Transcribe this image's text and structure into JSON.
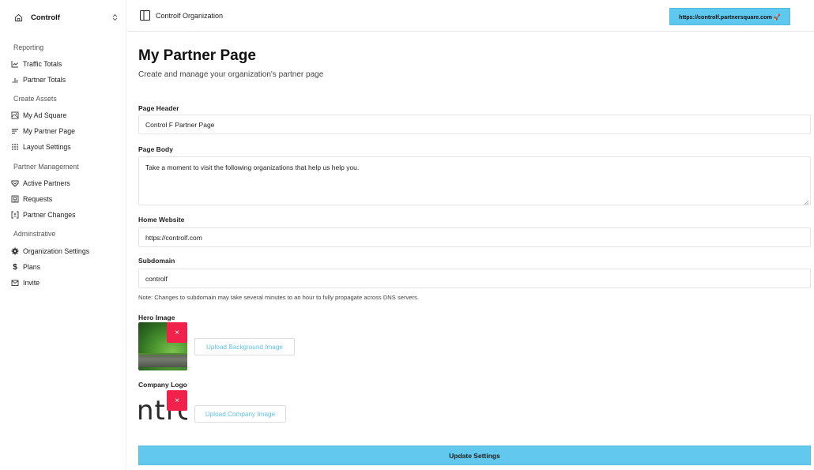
{
  "sidebar": {
    "org_name": "Controlf",
    "sections": [
      {
        "title": "Reporting",
        "items": [
          {
            "label": "Traffic Totals",
            "icon": "line-chart-icon"
          },
          {
            "label": "Partner Totals",
            "icon": "bar-chart-icon"
          }
        ]
      },
      {
        "title": "Create Assets",
        "items": [
          {
            "label": "My Ad Square",
            "icon": "image-square-icon"
          },
          {
            "label": "My Partner Page",
            "icon": "text-align-icon"
          },
          {
            "label": "Layout Settings",
            "icon": "grid-dots-icon"
          }
        ]
      },
      {
        "title": "Partner Management",
        "items": [
          {
            "label": "Active Partners",
            "icon": "handshake-icon"
          },
          {
            "label": "Requests",
            "icon": "inbox-icon"
          },
          {
            "label": "Partner Changes",
            "icon": "diff-icon"
          }
        ]
      },
      {
        "title": "Adminstrative",
        "items": [
          {
            "label": "Organization Settings",
            "icon": "gear-icon"
          },
          {
            "label": "Plans",
            "icon": "dollar-icon"
          },
          {
            "label": "Invite",
            "icon": "mail-icon"
          }
        ]
      }
    ]
  },
  "topbar": {
    "title": "Controlf Organization",
    "url_badge": "https://controlf.partnersquare.com 🚀"
  },
  "page": {
    "title": "My Partner Page",
    "subtitle": "Create and manage your organization's partner page"
  },
  "form": {
    "page_header": {
      "label": "Page Header",
      "value": "Control F Partner Page"
    },
    "page_body": {
      "label": "Page Body",
      "value": "Take a moment to visit the following organizations that help us help you."
    },
    "home_website": {
      "label": "Home Website",
      "value": "https://controlf.com"
    },
    "subdomain": {
      "label": "Subdomain",
      "value": "controlf",
      "note": "Note: Changes to subdomain may take several minutes to an hour to fully propagate across DNS servers."
    },
    "hero_image": {
      "label": "Hero Image",
      "remove": "×",
      "upload_label": "Upload Background Image"
    },
    "company_logo": {
      "label": "Company Logo",
      "remove": "×",
      "upload_label": "Upload Company Image",
      "logo_text": "ntrc"
    },
    "submit_label": "Update Settings"
  },
  "colors": {
    "accent": "#63c8ed",
    "danger": "#f0224c",
    "upload_text": "#5fc0ea"
  }
}
